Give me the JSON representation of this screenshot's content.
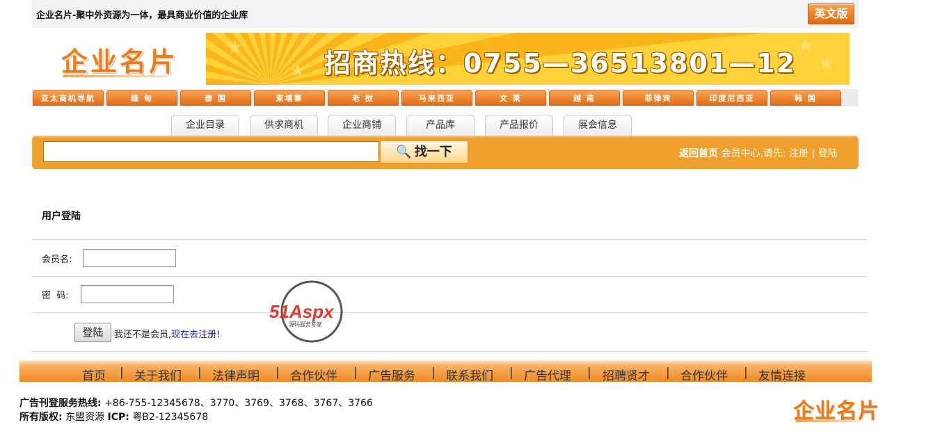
{
  "header": {
    "slogan": "企业名片-聚中外资源为一体，最具商业价值的企业库",
    "english_button": "英文版",
    "logo_text": "企业名片",
    "banner_text": "招商热线：0755—36513801—12"
  },
  "nav_tabs": [
    "亚太商机导航",
    "缅 甸",
    "泰 国",
    "柬埔寨",
    "老 挝",
    "马来西亚",
    "文 莱",
    "越 南",
    "菲律宾",
    "印度尼西亚",
    "韩 国"
  ],
  "sub_tabs": [
    "企业目录",
    "供求商机",
    "企业商铺",
    "产品库",
    "产品报价",
    "展会信息"
  ],
  "search": {
    "value": "",
    "button_label": "找一下",
    "button_icon": "search-icon"
  },
  "member": {
    "home_link": "返回首页",
    "prompt": "会员中心,请先:",
    "register": "注册",
    "separator": "|",
    "login": "登陆"
  },
  "login_form": {
    "title": "用户登陆",
    "username_label": "会员名:",
    "password_label": "密  码:",
    "submit_label": "登陆",
    "not_member_text": "我还不是会员,",
    "register_link": "现在去注册",
    "exclaim": "!"
  },
  "watermark": {
    "brand": "51Aspx",
    "tagline": "源码服务专家"
  },
  "footer_nav": [
    "首页",
    "关于我们",
    "法律声明",
    "合作伙伴",
    "广告服务",
    "联系我们",
    "广告代理",
    "招聘贤才",
    "合作伙伴",
    "友情连接"
  ],
  "footer": {
    "hotline_label": "广告刊登服务热线:",
    "hotline_value": "+86-755-12345678、3770、3769、3768、3767、3766",
    "copyright_label": "所有版权:",
    "copyright_value": "东盟资源",
    "icp_label": "ICP:",
    "icp_value": "粤B2-12345678",
    "logo_text": "企业名片"
  },
  "colors": {
    "accent_orange": "#efa02c",
    "tab_orange": "#e46c14",
    "logo_orange": "#ef7a18"
  }
}
